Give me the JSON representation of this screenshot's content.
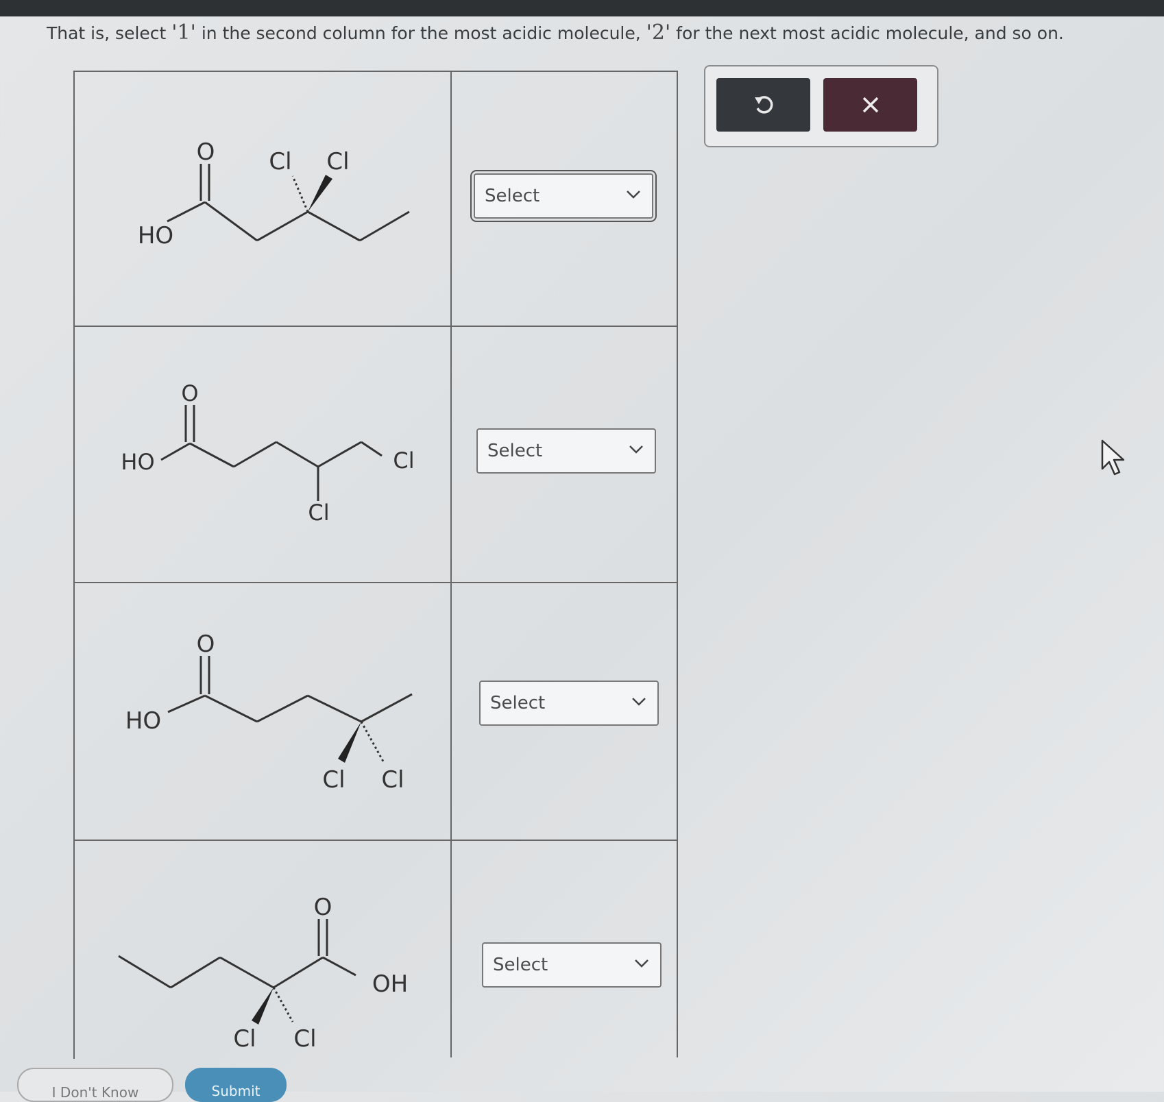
{
  "instruction": {
    "before": "That is, select ",
    "mark_one": "'1'",
    "middle": " in the second column for the most acidic molecule, ",
    "mark_two": "'2'",
    "after": " for the next most acidic molecule, and so on."
  },
  "molecules": [
    {
      "labels": {
        "o": "O",
        "ho": "HO",
        "cl1": "Cl",
        "cl2": "Cl"
      },
      "select_value": "Select"
    },
    {
      "labels": {
        "o": "O",
        "ho": "HO",
        "cl1": "Cl",
        "cl2": "Cl"
      },
      "select_value": "Select"
    },
    {
      "labels": {
        "o": "O",
        "ho": "HO",
        "cl1": "Cl",
        "cl2": "Cl"
      },
      "select_value": "Select"
    },
    {
      "labels": {
        "o": "O",
        "oh": "OH",
        "cl1": "Cl",
        "cl2": "Cl"
      },
      "select_value": "Select"
    }
  ],
  "toolbar": {
    "undo_icon": "undo-icon",
    "close_icon": "close-icon"
  },
  "buttons": {
    "dont_know": "I Don't Know",
    "submit": "Submit"
  }
}
